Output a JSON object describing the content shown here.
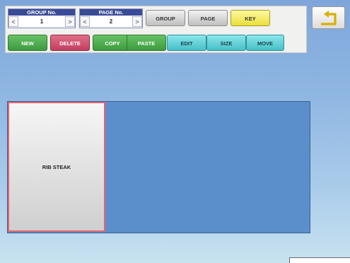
{
  "nav": {
    "group": {
      "title": "GROUP No.",
      "value": "1",
      "prev": "<",
      "next": ">"
    },
    "page": {
      "title": "PAGE No.",
      "value": "2",
      "prev": "<",
      "next": ">"
    }
  },
  "mode_buttons": {
    "group": "GROUP",
    "page": "PAGE",
    "key": "KEY"
  },
  "action_buttons": {
    "new": "NEW",
    "delete": "DELETE",
    "copy": "COPY",
    "paste": "PASTE",
    "edit": "EDIT",
    "size": "SIZE",
    "move": "MOVE"
  },
  "back": {
    "icon": "back-arrow-icon"
  },
  "key_area": {
    "keys": [
      {
        "label": "RIB STEAK",
        "selected": true
      }
    ]
  },
  "colors": {
    "background_top": "#7ea6da",
    "key_area": "#5b8fcc",
    "selected_border": "#e2646e",
    "key_button": "#e9df3b",
    "nav_header": "#3a4b98"
  }
}
